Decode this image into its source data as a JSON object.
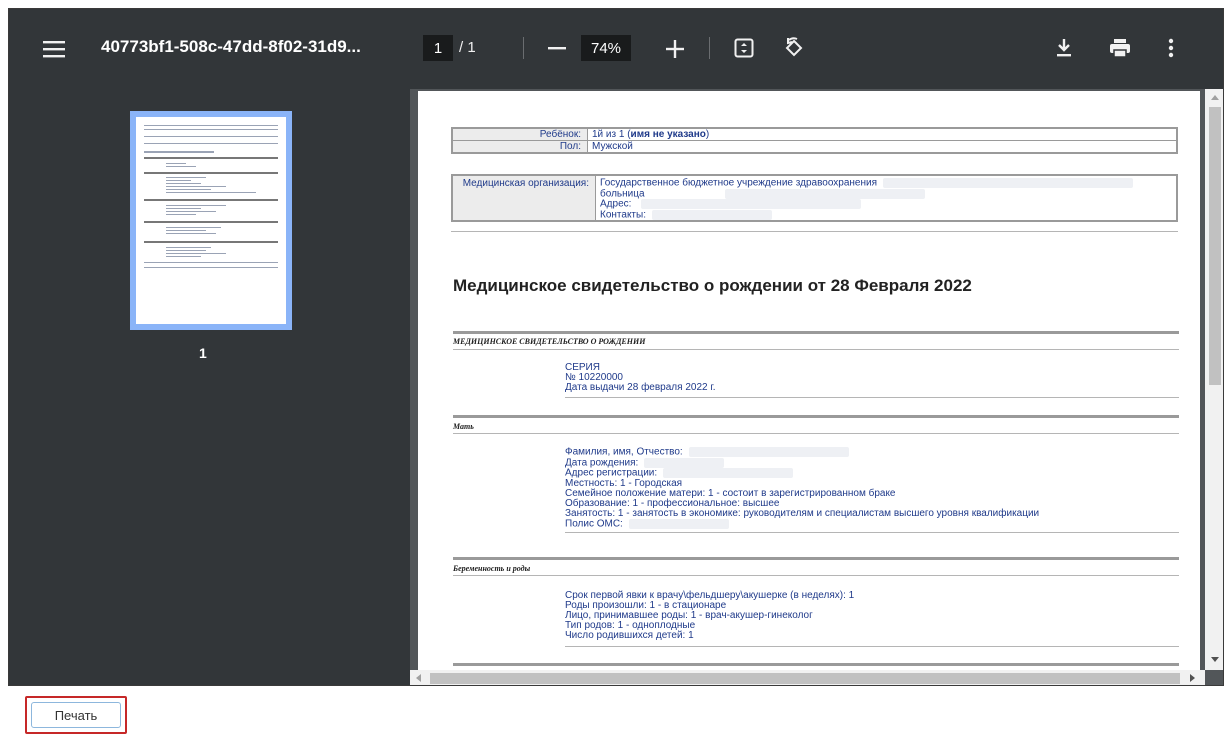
{
  "toolbar": {
    "title": "40773bf1-508c-47dd-8f02-31d9...",
    "page_current": "1",
    "page_total": "/ 1",
    "zoom": "74%"
  },
  "sidebar": {
    "thumb_page_number": "1"
  },
  "document": {
    "child_table": [
      {
        "label": "Ребёнок:",
        "value_prefix": "1й из 1 (",
        "value_bold": "имя не указано",
        "value_suffix": ")"
      },
      {
        "label": "Пол:",
        "value": "Мужской"
      }
    ],
    "org_table": {
      "label": "Медицинская организация:",
      "lines": [
        "Государственное бюджетное учреждение здравоохранения",
        "больница",
        "Адрес:",
        "Контакты:"
      ]
    },
    "heading": "Медицинское свидетельство о рождении от 28 Февраля 2022",
    "sections": [
      {
        "title": "МЕДИЦИНСКОЕ СВИДЕТЕЛЬСТВО О РОЖДЕНИИ",
        "lines": [
          "СЕРИЯ",
          "№ 10220000",
          "Дата выдачи 28 февраля 2022 г."
        ]
      },
      {
        "title": "Мать",
        "lines": [
          "Фамилия, имя, Отчество:",
          "Дата рождения:",
          "Адрес регистрации:",
          "Местность: 1 - Городская",
          "Семейное положение матери: 1 - состоит в зарегистрированном браке",
          "Образование: 1 - профессиональное: высшее",
          "Занятость: 1 - занятость в экономике: руководителям и специалистам высшего уровня квалификации",
          "Полис ОМС:"
        ]
      },
      {
        "title": "Беременность и роды",
        "lines": [
          "Срок первой явки к врачу\\фельдшеру\\акушерке (в неделях): 1",
          "Роды произошли: 1 - в стационаре",
          "Лицо, принимавшее роды: 1 - врач-акушер-гинеколог",
          "Тип родов: 1 - одноплодные",
          "Число родившихся детей: 1"
        ]
      }
    ]
  },
  "footer": {
    "print_label": "Печать"
  },
  "colors": {
    "toolbar_bg": "#323639",
    "viewer_bg": "#525659",
    "thumb_highlight": "#8ab4f8",
    "print_border": "#c62828"
  }
}
